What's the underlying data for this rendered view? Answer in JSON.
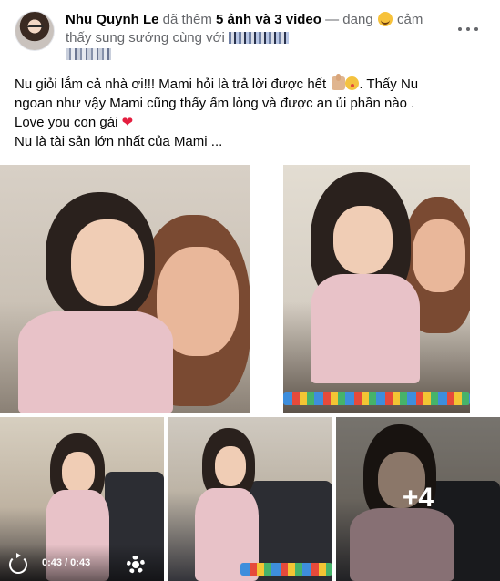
{
  "header": {
    "author": "Nhu Quynh Le",
    "action_prefix": " đã thêm ",
    "media_count": "5 ảnh và 3 video",
    "feeling_prefix": " — đang ",
    "feeling": "cảm",
    "feeling_cont": "thấy sung sướng cùng với",
    "more_icon": "more-horizontal-icon"
  },
  "caption": {
    "line1_a": "Nu giỏi lắm cả nhà ơi!!! Mami hỏi là trả lời được hết ",
    "line1_b": ". Thấy Nu",
    "line2": "ngoan như vậy Mami cũng thấy ấm lòng và được an ủi phần nào .",
    "line3": "Love you con gái ",
    "line4": "Nu là tài sản lớn nhất  của Mami ..."
  },
  "media": {
    "more_count": "+4",
    "video_time": "0:43 / 0:43"
  },
  "colors": {
    "name": "#050505",
    "secondary": "#65676b",
    "heart": "#e41e3f"
  }
}
